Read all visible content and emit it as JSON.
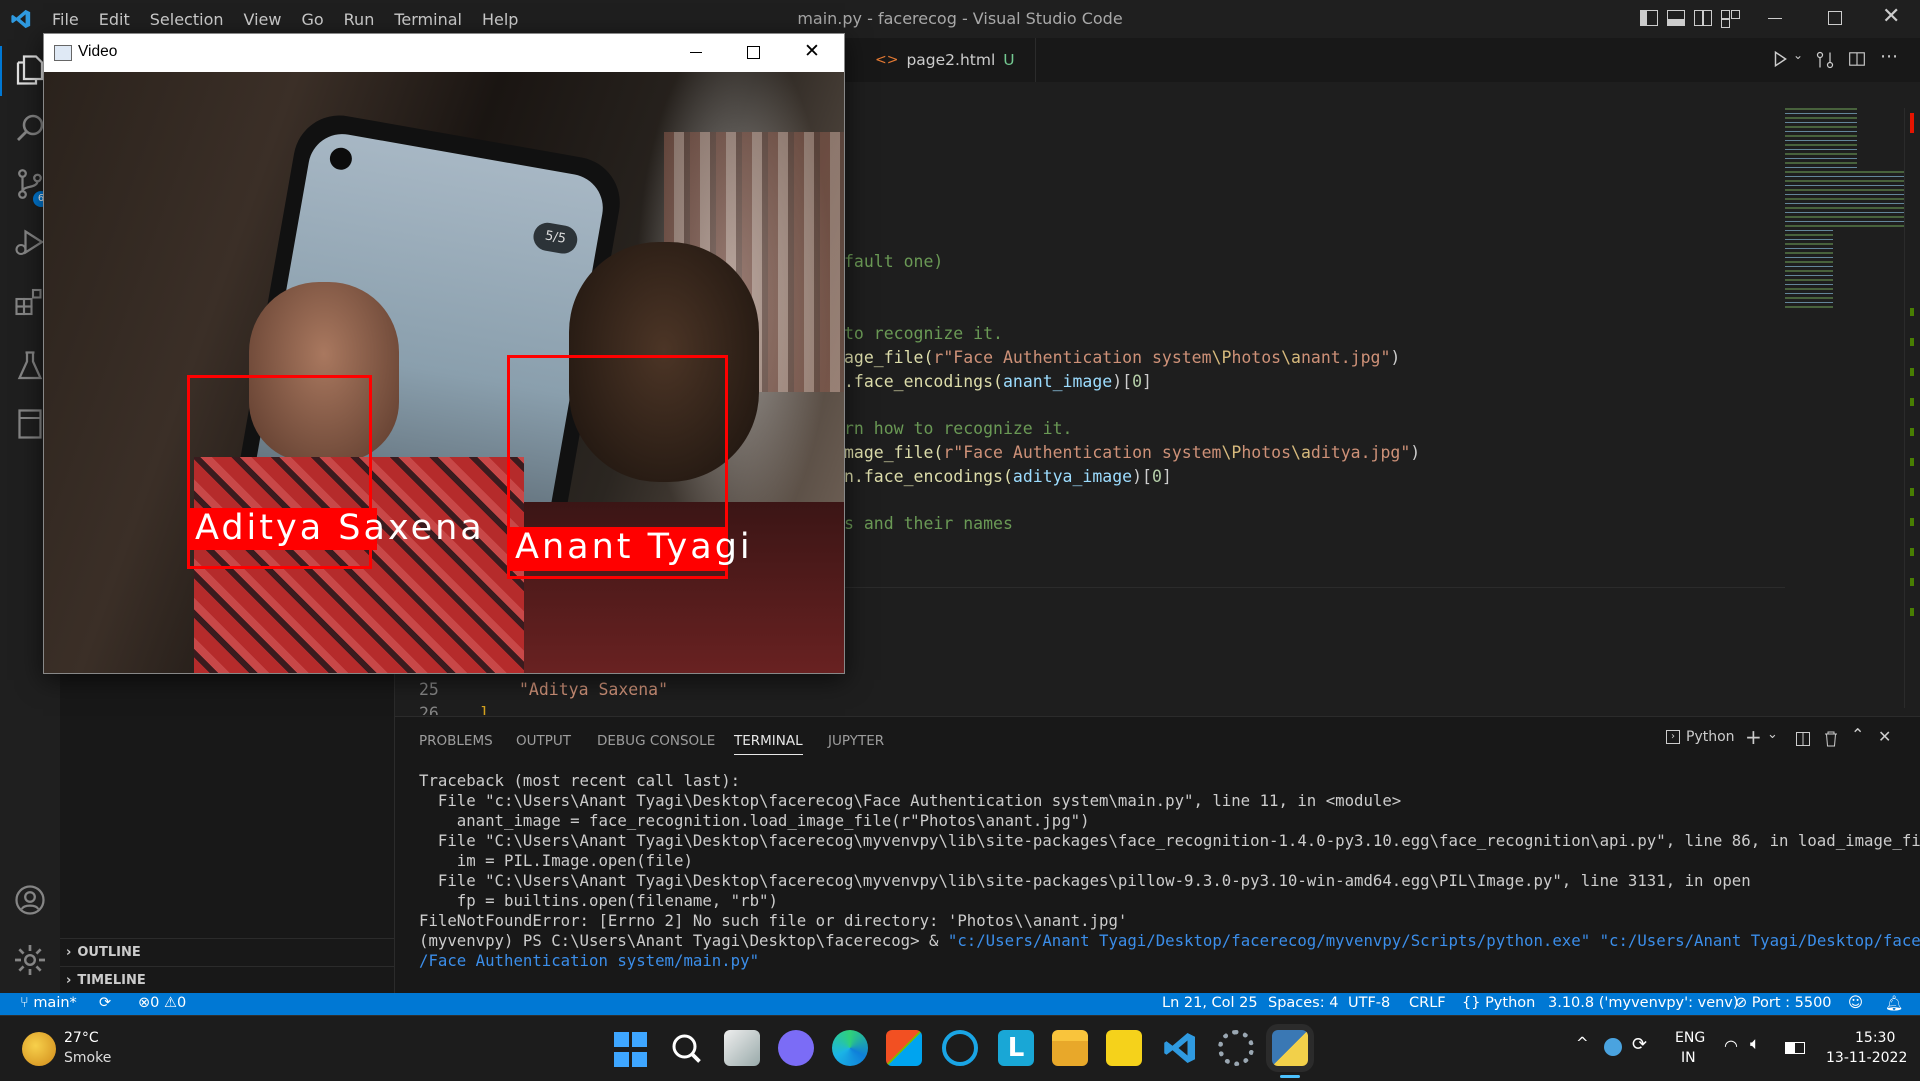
{
  "titlebar": {
    "menu": [
      "File",
      "Edit",
      "Selection",
      "View",
      "Go",
      "Run",
      "Terminal",
      "Help"
    ],
    "title": "main.py - facerecog - Visual Studio Code"
  },
  "activity": {
    "scm_badge": "6"
  },
  "sidebar": {
    "outline": "OUTLINE",
    "timeline": "TIMELINE"
  },
  "editor": {
    "tab": {
      "label": "page2.html",
      "status": "U"
    },
    "lines": {
      "l1": "fault one)",
      "l2": "to recognize it.",
      "l3a": "age_file(",
      "l3b": "r\"Face Authentication system",
      "l3c": "\\P",
      "l3d": "hotos",
      "l3e": "\\a",
      "l3f": "nant.jpg\"",
      "l3g": ")",
      "l4a": ".face_encodings(",
      "l4b": "anant_image",
      "l4c": ")[",
      "l4d": "0",
      "l4e": "]",
      "l5": "rn how to recognize it.",
      "l6a": "mage_file(",
      "l6b": "r\"Face Authentication system",
      "l6c": "\\P",
      "l6d": "hotos",
      "l6e": "\\a",
      "l6f": "ditya.jpg\"",
      "l6g": ")",
      "l7a": "n.face_encodings(",
      "l7b": "aditya_image",
      "l7c": ")[",
      "l7d": "0",
      "l7e": "]",
      "l8": "s and their names",
      "ln25": "25",
      "ln26": "26",
      "code25": "\"Aditya Saxena\"",
      "code26": "]"
    }
  },
  "panel": {
    "tabs": [
      "PROBLEMS",
      "OUTPUT",
      "DEBUG CONSOLE",
      "TERMINAL",
      "JUPYTER"
    ],
    "shell": "Python",
    "terminal": [
      "Traceback (most recent call last):",
      "  File \"c:\\Users\\Anant Tyagi\\Desktop\\facerecog\\Face Authentication system\\main.py\", line 11, in <module>",
      "    anant_image = face_recognition.load_image_file(r\"Photos\\anant.jpg\")",
      "  File \"C:\\Users\\Anant Tyagi\\Desktop\\facerecog\\myvenvpy\\lib\\site-packages\\face_recognition-1.4.0-py3.10.egg\\face_recognition\\api.py\", line 86, in load_image_file",
      "    im = PIL.Image.open(file)",
      "  File \"C:\\Users\\Anant Tyagi\\Desktop\\facerecog\\myvenvpy\\lib\\site-packages\\pillow-9.3.0-py3.10-win-amd64.egg\\PIL\\Image.py\", line 3131, in open",
      "    fp = builtins.open(filename, \"rb\")",
      "FileNotFoundError: [Errno 2] No such file or directory: 'Photos\\\\anant.jpg'"
    ],
    "prompt": "(myvenvpy) PS C:\\Users\\Anant Tyagi\\Desktop\\facerecog> & ",
    "cmd1": "\"c:/Users/Anant Tyagi/Desktop/facerecog/myvenvpy/Scripts/python.exe\" \"c:/Users/Anant Tyagi/Desktop/facerecog",
    "cmd2": "/Face Authentication system/main.py\""
  },
  "statusbar": {
    "branch": "main*",
    "errors": "0",
    "warnings": "0",
    "position": "Ln 21, Col 25",
    "spaces": "Spaces: 4",
    "encoding": "UTF-8",
    "eol": "CRLF",
    "language": "Python",
    "interpreter": "3.10.8 ('myvenvpy': venv)",
    "port": "Port : 5500"
  },
  "video": {
    "title": "Video",
    "labels": [
      "Aditya Saxena",
      "Anant Tyagi"
    ],
    "phone_counter": "5/5"
  },
  "taskbar": {
    "weather_temp": "27°C",
    "weather_desc": "Smoke",
    "lang1": "ENG",
    "lang2": "IN",
    "time": "15:30",
    "date": "13-11-2022"
  },
  "colors": {
    "accent": "#0078d4",
    "facebox": "#ff0000",
    "link": "#3b8eea"
  }
}
